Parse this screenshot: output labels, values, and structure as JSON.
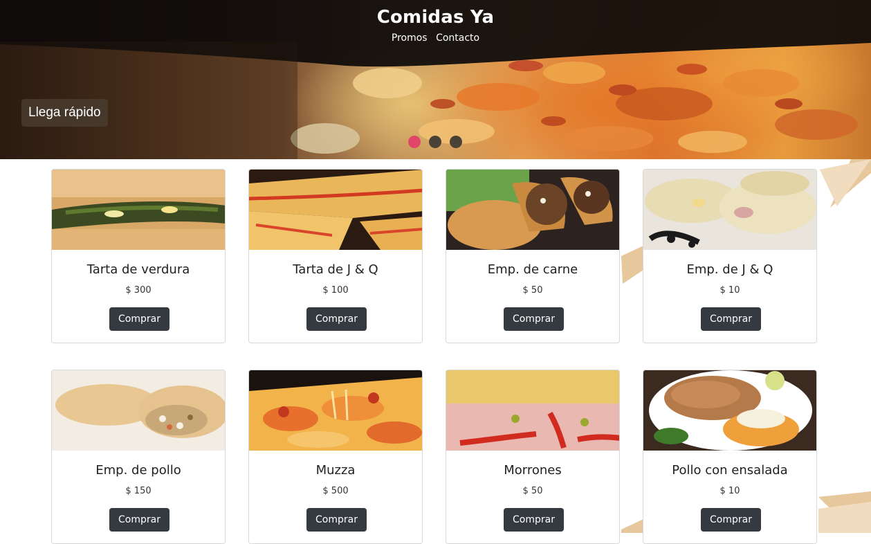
{
  "header": {
    "title": "Comidas Ya",
    "links": [
      "Promos",
      "Contacto"
    ]
  },
  "carousel": {
    "caption": "Llega rápido",
    "slide_count": 3,
    "active_index": 0,
    "active_color": "#e0466a",
    "inactive_color": "#4a4236"
  },
  "products": [
    {
      "name": "Tarta de verdura",
      "price": "$ 300",
      "button": "Comprar"
    },
    {
      "name": "Tarta de J & Q",
      "price": "$ 100",
      "button": "Comprar"
    },
    {
      "name": "Emp. de carne",
      "price": "$ 50",
      "button": "Comprar"
    },
    {
      "name": "Emp. de J & Q",
      "price": "$ 10",
      "button": "Comprar"
    },
    {
      "name": "Emp. de pollo",
      "price": "$ 150",
      "button": "Comprar"
    },
    {
      "name": "Muzza",
      "price": "$ 500",
      "button": "Comprar"
    },
    {
      "name": "Morrones",
      "price": "$ 50",
      "button": "Comprar"
    },
    {
      "name": "Pollo con ensalada",
      "price": "$ 10",
      "button": "Comprar"
    }
  ],
  "colors": {
    "button_bg": "#343a40",
    "button_text": "#ffffff"
  }
}
